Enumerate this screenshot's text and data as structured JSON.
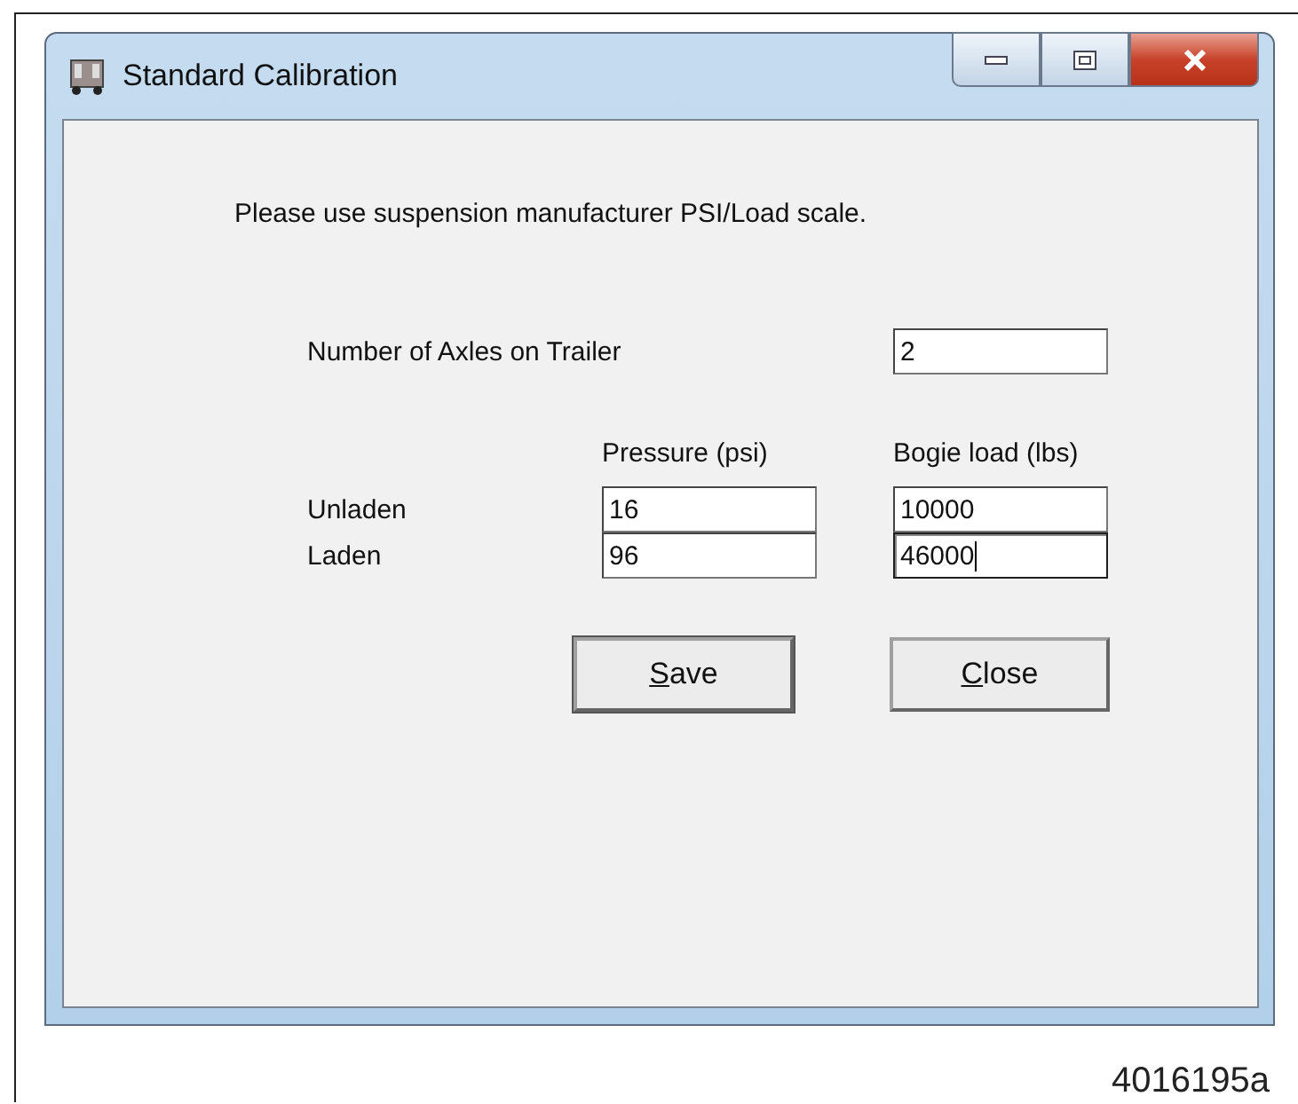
{
  "window": {
    "title": "Standard Calibration"
  },
  "instruction": "Please use suspension manufacturer PSI/Load scale.",
  "axles": {
    "label": "Number of Axles on Trailer",
    "value": "2"
  },
  "columns": [
    "Pressure (psi)",
    "Bogie load (lbs)"
  ],
  "rows": [
    {
      "label": "Unladen",
      "pressure": {
        "value": "16",
        "focused": false
      },
      "load": {
        "value": "10000",
        "focused": false
      }
    },
    {
      "label": "Laden",
      "pressure": {
        "value": "96",
        "focused": false
      },
      "load": {
        "value": "46000",
        "focused": true
      }
    }
  ],
  "buttons": [
    {
      "accel": "S",
      "rest": "ave",
      "default": true
    },
    {
      "accel": "C",
      "rest": "lose",
      "default": false
    }
  ],
  "figure_number": "4016195a"
}
